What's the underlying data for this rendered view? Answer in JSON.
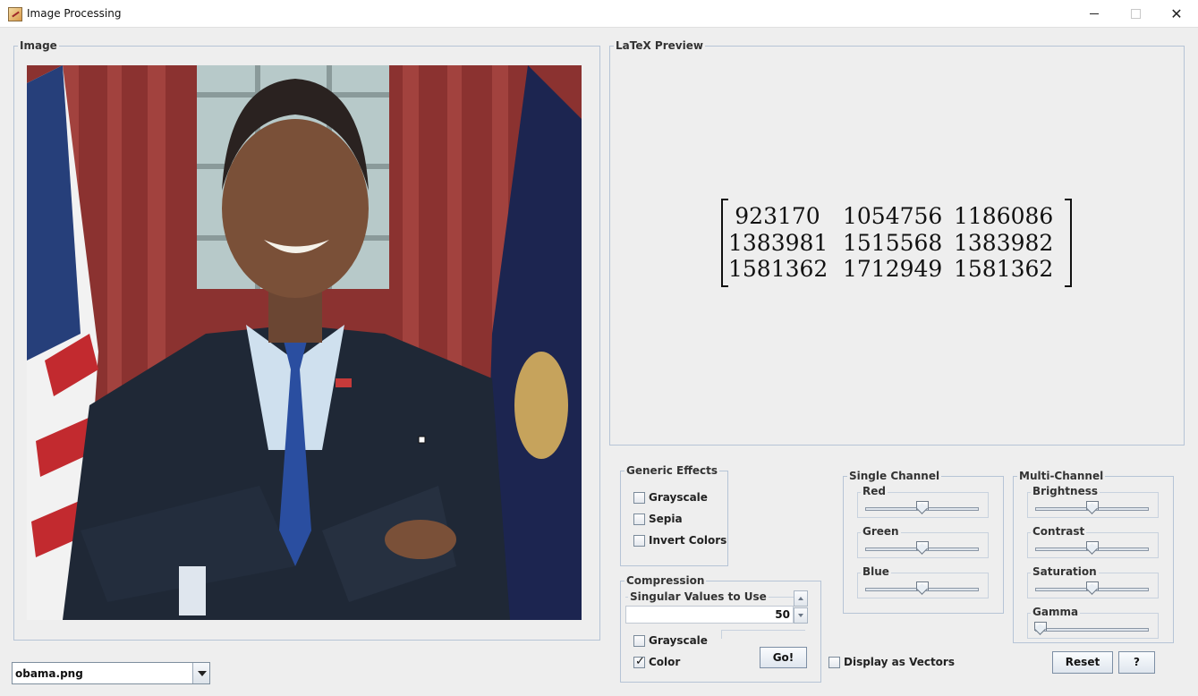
{
  "window": {
    "title": "Image Processing"
  },
  "image_panel": {
    "title": "Image",
    "subject": "portrait"
  },
  "latex_panel": {
    "title": "LaTeX Preview",
    "matrix": [
      [
        "923170",
        "1054756",
        "1186086"
      ],
      [
        "1383981",
        "1515568",
        "1383982"
      ],
      [
        "1581362",
        "1712949",
        "1581362"
      ]
    ]
  },
  "generic_effects": {
    "title": "Generic Effects",
    "grayscale": {
      "label": "Grayscale",
      "checked": false
    },
    "sepia": {
      "label": "Sepia",
      "checked": false
    },
    "invert": {
      "label": "Invert Colors",
      "checked": false
    }
  },
  "compression": {
    "title": "Compression",
    "singular_values_label": "Singular Values to Use",
    "singular_values": "50",
    "grayscale": {
      "label": "Grayscale",
      "checked": false
    },
    "color": {
      "label": "Color",
      "checked": true,
      "mark": "✓"
    },
    "go_label": "Go!"
  },
  "display_vectors": {
    "label": "Display as Vectors",
    "checked": false
  },
  "single_channel": {
    "title": "Single Channel",
    "red": {
      "label": "Red",
      "level": 0.5
    },
    "green": {
      "label": "Green",
      "level": 0.5
    },
    "blue": {
      "label": "Blue",
      "level": 0.5
    }
  },
  "multi_channel": {
    "title": "Multi-Channel",
    "brightness": {
      "label": "Brightness",
      "level": 0.5
    },
    "contrast": {
      "label": "Contrast",
      "level": 0.5
    },
    "saturation": {
      "label": "Saturation",
      "level": 0.5
    },
    "gamma": {
      "label": "Gamma",
      "level": 0.05
    }
  },
  "reset_label": "Reset",
  "help_label": "?",
  "file_combo": {
    "value": "obama.png"
  }
}
